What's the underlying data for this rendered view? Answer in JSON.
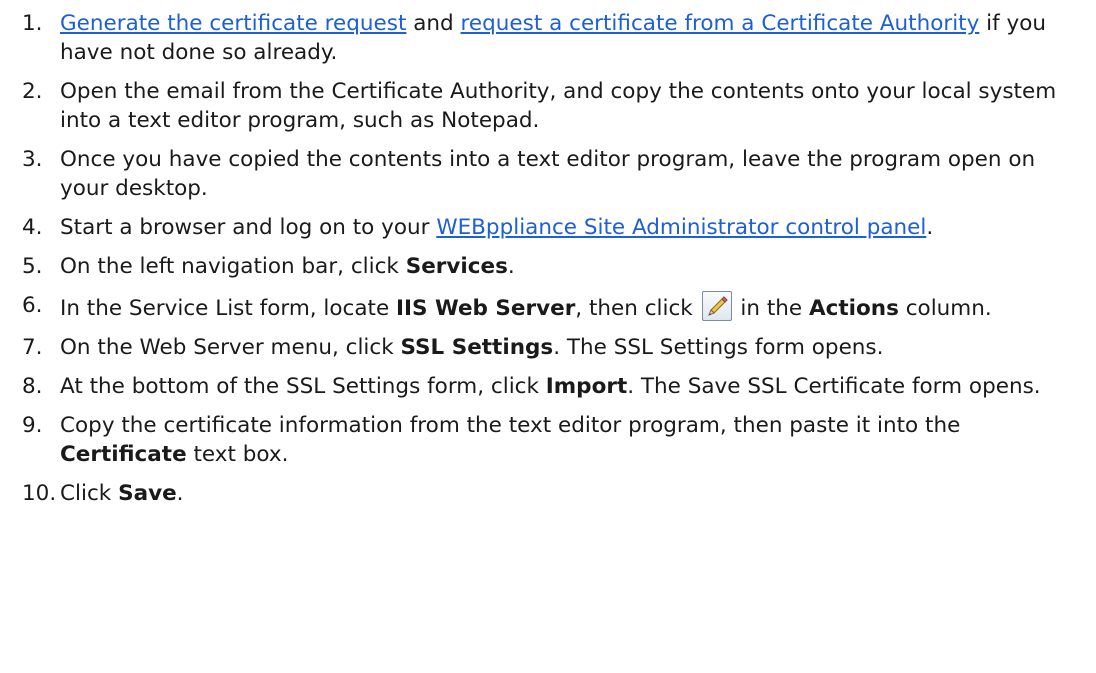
{
  "steps": [
    {
      "num": "1.",
      "link1": "Generate the certificate request",
      "text_and": " and ",
      "link2": "request a certificate from a Certificate Authority",
      "text_after": " if you have not done so already."
    },
    {
      "num": "2.",
      "text": "Open the email from the Certificate Authority, and copy the contents onto your local system into a text editor program, such as Notepad."
    },
    {
      "num": "3.",
      "text": "Once you have copied the contents into a text editor program, leave the program open on your desktop."
    },
    {
      "num": "4.",
      "text_before": "Start a browser and log on to your ",
      "link": "WEBppliance Site Administrator control panel",
      "text_after": "."
    },
    {
      "num": "5.",
      "text_before": "On the left navigation bar, click ",
      "bold": "Services",
      "text_after": "."
    },
    {
      "num": "6.",
      "text_before": "In the Service List form, locate ",
      "bold1": "IIS Web Server",
      "text_mid": ", then click ",
      "icon": "edit-pencil-icon",
      "text_mid2": " in the ",
      "bold2": "Actions",
      "text_after": " column."
    },
    {
      "num": "7.",
      "text_before": "On the Web Server menu, click ",
      "bold": "SSL Settings",
      "text_after": ". The SSL Settings form opens."
    },
    {
      "num": "8.",
      "text_before": "At the bottom of the SSL Settings form, click ",
      "bold": "Import",
      "text_after": ". The Save SSL Certificate form opens."
    },
    {
      "num": "9.",
      "text_before": "Copy the certificate information from the text editor program, then paste it into the ",
      "bold": "Certificate",
      "text_after": " text box."
    },
    {
      "num": "10.",
      "text_before": "Click ",
      "bold": "Save",
      "text_after": "."
    }
  ],
  "colors": {
    "link": "#1c5fd6",
    "text": "#1a1a1a"
  }
}
